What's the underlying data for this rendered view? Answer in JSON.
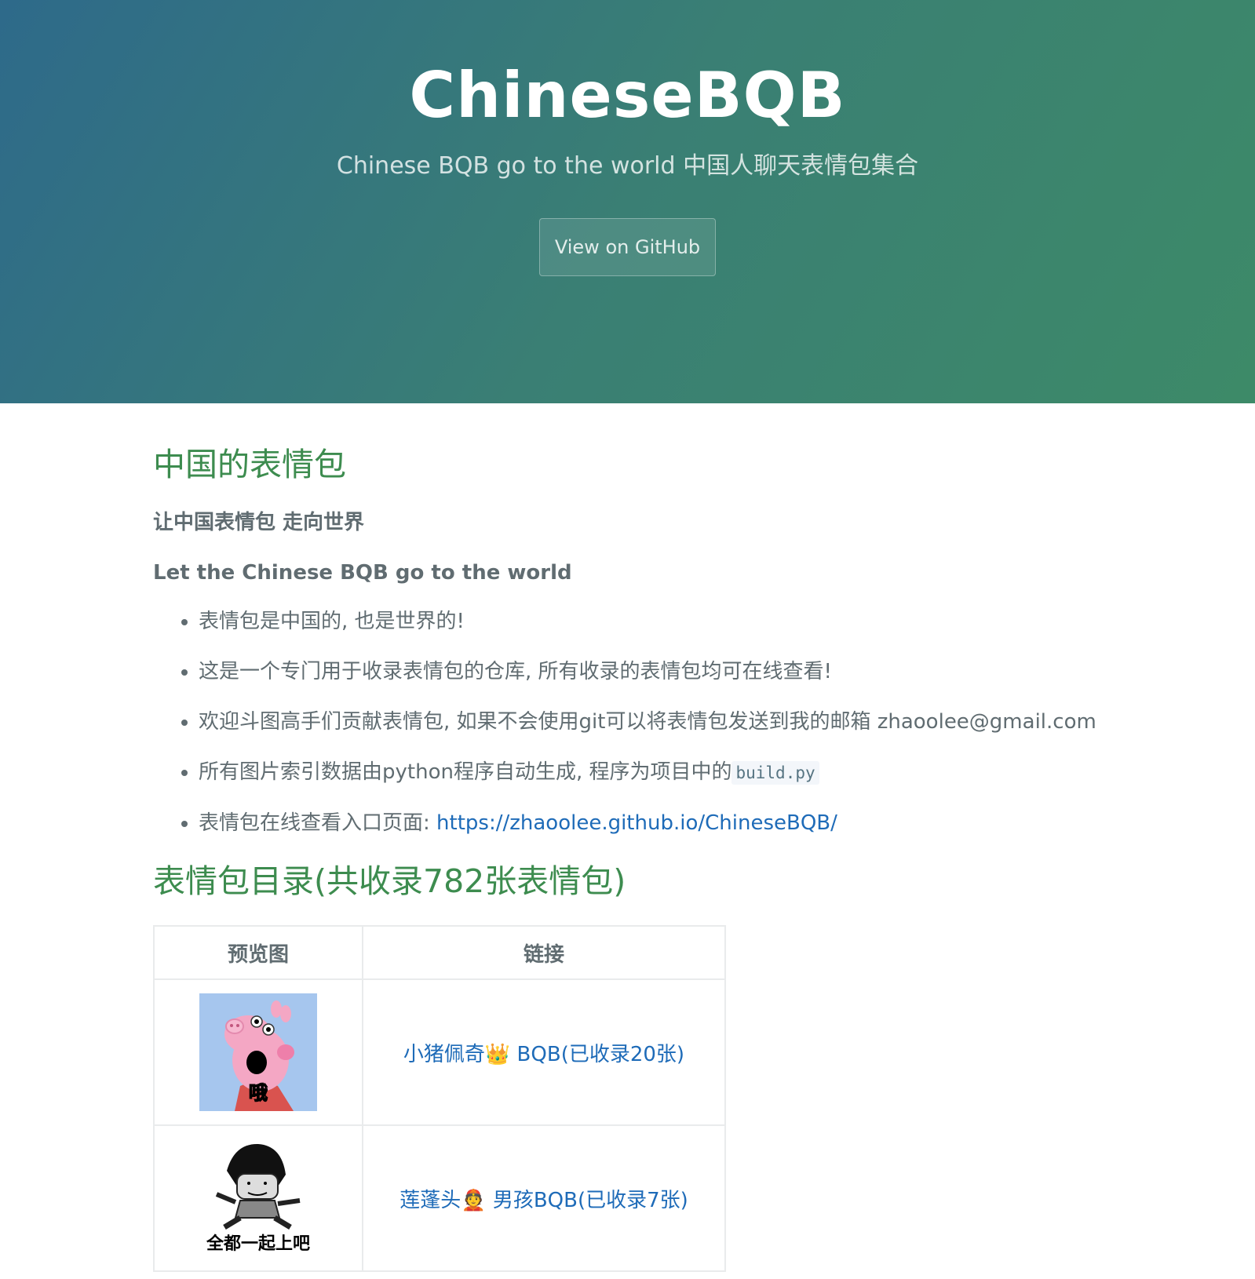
{
  "header": {
    "title": "ChineseBQB",
    "tagline": "Chinese BQB go to the world 中国人聊天表情包集合",
    "github_button": "View on GitHub"
  },
  "section1": {
    "heading": "中国的表情包",
    "strong_cn": "让中国表情包 走向世界",
    "strong_en": "Let the Chinese BQB go to the world",
    "bullets": {
      "b1": "表情包是中国的, 也是世界的!",
      "b2": "这是一个专门用于收录表情包的仓库, 所有收录的表情包均可在线查看!",
      "b3": "欢迎斗图高手们贡献表情包, 如果不会使用git可以将表情包发送到我的邮箱 zhaoolee@gmail.com",
      "b4_text": "所有图片索引数据由python程序自动生成, 程序为项目中的",
      "b4_code": "build.py",
      "b5_text": "表情包在线查看入口页面: ",
      "b5_link": "https://zhaoolee.github.io/ChineseBQB/"
    }
  },
  "section2": {
    "heading": "表情包目录(共收录782张表情包)",
    "table": {
      "col_preview": "预览图",
      "col_link": "链接",
      "rows": [
        {
          "link": "小猪佩奇👑 BQB(已收录20张)",
          "preview_caption": "哦"
        },
        {
          "link": "莲蓬头👲 男孩BQB(已收录7张)",
          "preview_caption": "全都一起上吧"
        }
      ]
    }
  }
}
